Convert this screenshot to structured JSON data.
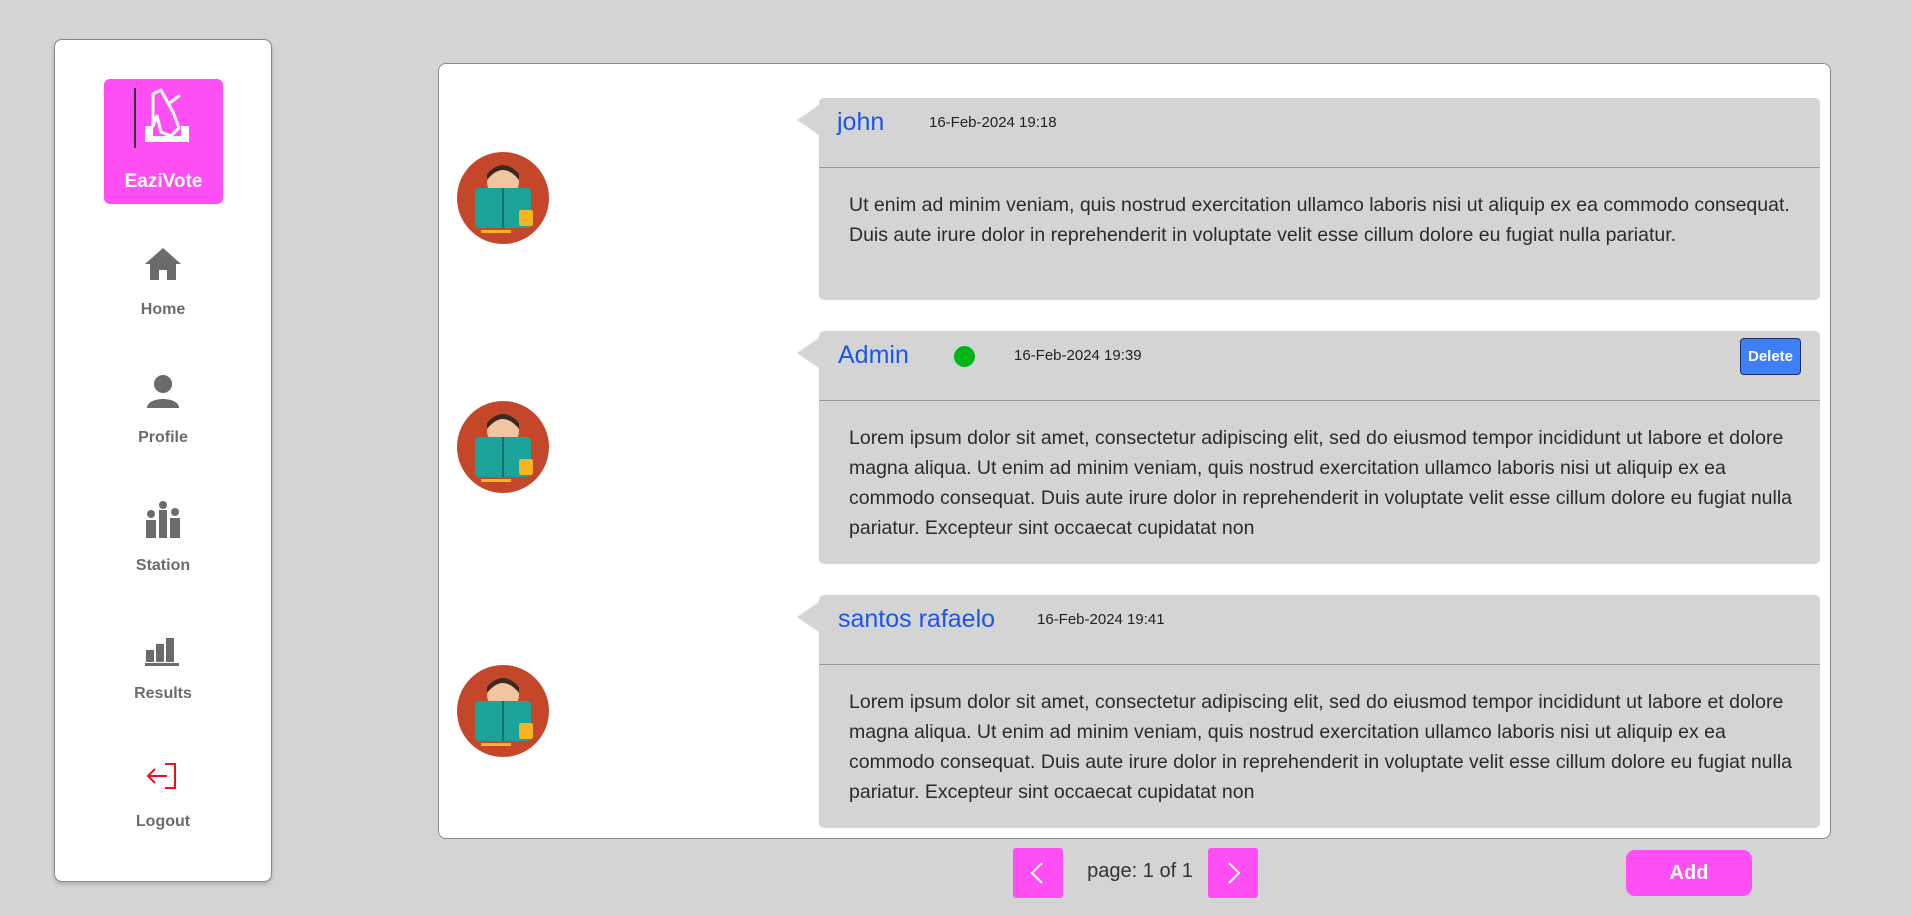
{
  "sidebar": {
    "logo_text": "EaziVote",
    "items": [
      {
        "label": "Home",
        "icon": "home-icon"
      },
      {
        "label": "Profile",
        "icon": "user-icon"
      },
      {
        "label": "Station",
        "icon": "people-icon"
      },
      {
        "label": "Results",
        "icon": "bar-chart-icon"
      },
      {
        "label": "Logout",
        "icon": "logout-icon"
      }
    ]
  },
  "comments": [
    {
      "author": "john",
      "timestamp": "16-Feb-2024 19:18",
      "online": false,
      "text": "Ut enim ad minim veniam, quis nostrud exercitation ullamco laboris nisi ut aliquip ex ea commodo consequat. Duis aute irure dolor in reprehenderit in voluptate velit esse cillum dolore eu fugiat nulla pariatur."
    },
    {
      "author": "Admin",
      "timestamp": "16-Feb-2024 19:39",
      "online": true,
      "delete_label": "Delete",
      "text": "Lorem ipsum dolor sit amet, consectetur adipiscing elit, sed do eiusmod tempor incididunt ut labore et dolore magna aliqua. Ut enim ad minim veniam, quis nostrud exercitation ullamco laboris nisi ut aliquip ex ea commodo consequat. Duis aute irure dolor in reprehenderit in voluptate velit esse cillum dolore eu fugiat nulla pariatur. Excepteur sint occaecat cupidatat non"
    },
    {
      "author": "santos rafaelo",
      "timestamp": "16-Feb-2024 19:41",
      "online": false,
      "text": "Lorem ipsum dolor sit amet, consectetur adipiscing elit, sed do eiusmod tempor incididunt ut labore et dolore magna aliqua. Ut enim ad minim veniam, quis nostrud exercitation ullamco laboris nisi ut aliquip ex ea commodo consequat. Duis aute irure dolor in reprehenderit in voluptate velit esse cillum dolore eu fugiat nulla pariatur. Excepteur sint occaecat cupidatat non"
    }
  ],
  "pagination": {
    "label": "page: 1 of 1"
  },
  "add_label": "Add",
  "colors": {
    "accent": "#ff4ff4",
    "author": "#1a56e8",
    "online": "#00b51a",
    "delete": "#3d7ff5",
    "logout": "#e8101a"
  }
}
